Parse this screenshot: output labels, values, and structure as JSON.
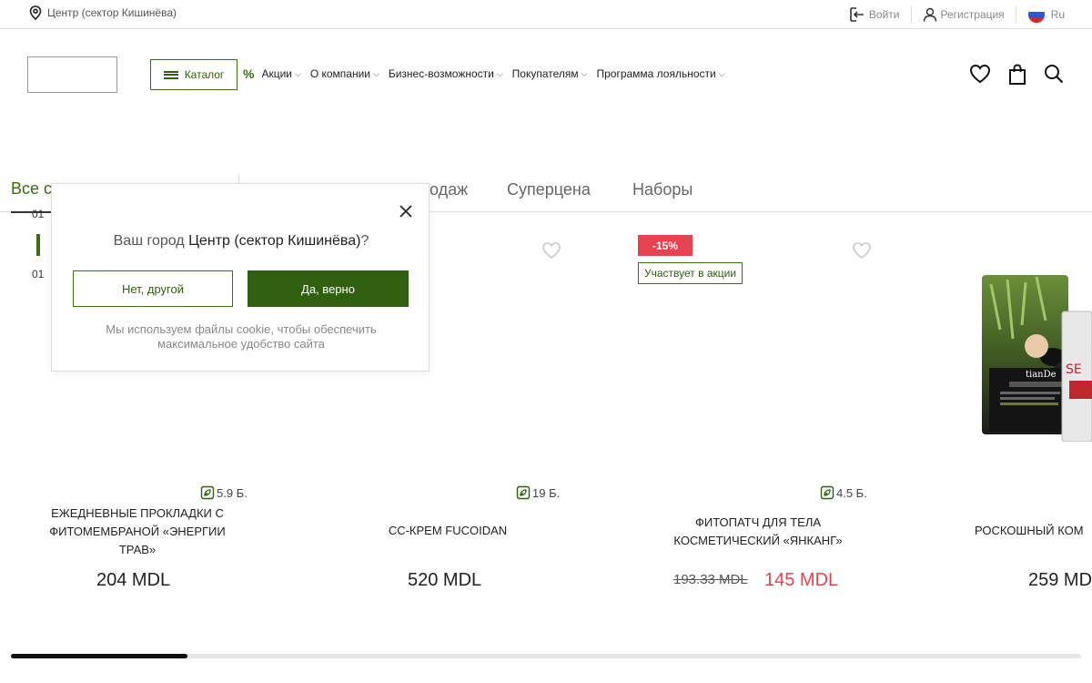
{
  "topbar": {
    "location": "Центр (сектор Кишинёва)",
    "login": "Войти",
    "register": "Регистрация",
    "language": "Ru"
  },
  "header": {
    "catalog": "Каталог",
    "nav": [
      {
        "label": "Акции"
      },
      {
        "label": "О компании"
      },
      {
        "label": "Бизнес-возможности"
      },
      {
        "label": "Покупателям"
      },
      {
        "label": "Программа лояльности"
      }
    ],
    "chevron": "⌵"
  },
  "tabs": {
    "all": "Все с",
    "items": [
      "родаж",
      "Суперцена",
      "Наборы"
    ]
  },
  "slider": {
    "top_num": "01",
    "bottom_num": "01"
  },
  "products": [
    {
      "title": "ЕЖЕДНЕВНЫЕ ПРОКЛАДКИ С ФИТОМЕМБРАНОЙ «ЭНЕРГИИ ТРАВ»",
      "points": "5.9 Б.",
      "price": "204 MDL"
    },
    {
      "title": "CC-КРЕМ FUCOIDAN",
      "points": "19 Б.",
      "price": "520 MDL"
    },
    {
      "title": "ФИТОПАТЧ ДЛЯ ТЕЛА КОСМЕТИЧЕСКИЙ «ЯНКАНГ»",
      "points": "4.5 Б.",
      "old_price": "193.33 MDL",
      "price": "145 MDL",
      "discount": "-15%",
      "promo": "Участвует в акции"
    },
    {
      "title": "РОСКОШНЫЙ КОМ",
      "price": "259 MD"
    }
  ],
  "popup": {
    "question_prefix": "Ваш город ",
    "city": "Центр (сектор Кишинёва)",
    "question_suffix": "?",
    "no_button": "Нет, другой",
    "yes_button": "Да, верно",
    "note": "Мы используем файлы cookie, чтобы обеспечить максимальное удобство сайта"
  },
  "product_image_text": "tianDe",
  "colors": {
    "brand_green": "#2f5f0f",
    "discount_red": "#e5434f"
  },
  "icons": {
    "location": "map-pin-icon",
    "login": "login-icon",
    "user": "user-icon",
    "favorites": "heart-icon",
    "cart": "bag-icon",
    "search": "search-icon",
    "close": "close-icon",
    "points": "leaf-points-icon"
  }
}
